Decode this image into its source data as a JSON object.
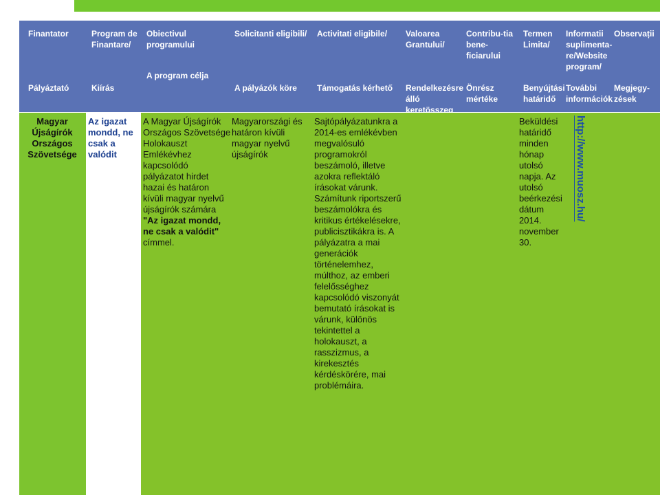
{
  "header_ro": {
    "finantator": "Finantator",
    "program": "Program de Finantare/",
    "obiectiv": "Obiectivul programului",
    "solicitanti": "Solicitanti eligibili/",
    "activitati": "Activitati eligibile/",
    "valoarea": "Valoarea Grantului/",
    "contributia": "Contribu-tia bene-ficiarului",
    "termen": "Termen Limita/",
    "informatii": "Informatii suplimenta-re/Website program/",
    "observatii": "Observații"
  },
  "header_hu": {
    "palyaztato": "Pályáztató",
    "kiiras": "Kiírás",
    "program_celja": "A program célja",
    "palyazok_kore": "A pályázók köre",
    "tamogatas": "Támogatás kérhető",
    "rendelkezesre": "Rendelkezésre álló keretösszeg",
    "onresz": "Önrész mértéke",
    "benyujtasi": "Benyújtási határidő",
    "tovabbi": "További információk",
    "megjegyzesek": "Megjegy-zések"
  },
  "row": {
    "palyaztato": "Magyar Újságírók Országos Szövetsége",
    "kiiras": "Az igazat mondd, ne csak a valódit",
    "program_celja_prefix": "A Magyar Újságírók Országos Szövetsége Holokauszt Emlékévhez kapcsolódó pályázatot hirdet hazai és határon kívüli magyar nyelvű újságírók számára ",
    "program_celja_bold": "\"Az igazat mondd, ne csak a valódit\"",
    "program_celja_suffix": " címmel.",
    "palyazok_kore": "Magyarországi és határon kívüli magyar nyelvű újságírók",
    "tamogatas": "Sajtópályázatunkra a 2014-es emlékévben megvalósuló programokról beszámoló, illetve azokra reflektáló írásokat várunk. Számítunk riportszerű beszámolókra és kritikus értékelésekre, publicisztikákra is. A pályázatra a mai generációk történelemhez, múlthoz, az emberi felelősséghez kapcsolódó viszonyát bemutató írásokat is várunk, különös tekintettel a holokauszt, a rasszizmus, a kirekesztés kérdéskörére, mai problémáira.",
    "hatarido": "Beküldési határidő minden hónap utolsó napja. Az utolsó beérkezési dátum 2014. november 30.",
    "website": "http://www.muosz.hu/"
  },
  "colors": {
    "header_bg": "#5a72b5",
    "row_green": "#84c22a",
    "link_blue": "#1c4fa8"
  }
}
